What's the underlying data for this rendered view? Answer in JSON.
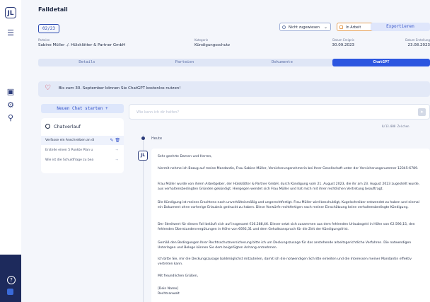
{
  "header": {
    "title": "Falldetail",
    "case_number": "02/23",
    "status_select": "Nicht zugewiesen",
    "progress_select": "In Arbeit",
    "export_label": "Exportieren"
  },
  "meta": {
    "parties_label": "Parteien",
    "parties_value": "Sabine Müller ./. Hülsklötter & Partner GmbH",
    "category_label": "Kategorie",
    "category_value": "Kündigungsschutz",
    "event_label": "Datum Ereignis",
    "event_value": "30.09.2023",
    "created_label": "Datum Erstellung",
    "created_value": "23.08.2023"
  },
  "tabs": [
    "Details",
    "Parteien",
    "Dokumente",
    "ChatGPT"
  ],
  "promo": {
    "text": "Bis zum 30. September können Sie ChatGPT kostenlos nutzen!"
  },
  "sidebar": {
    "new_chat": "Neuen Chat starten  +",
    "history_title": "Chatverlauf",
    "items": [
      "Verfasse ein Anschreiben an di",
      "Erstelle einen 5 Punkte Plan u",
      "Wie ist die Schuldfrage zu bea"
    ]
  },
  "input": {
    "placeholder": "Wie kann ich dir helfen?",
    "counter": "0/13.000 Zeichen"
  },
  "timeline": {
    "today": "Heute"
  },
  "rail": {
    "logo": "JL",
    "chat_avatar": "JL"
  },
  "message": {
    "paragraphs": [
      "Sehr geehrte Damen und Herren,",
      "hiermit nehme ich Bezug auf meine Mandantin, Frau Sabine Müller, Versicherungsnehmerin bei Ihrer Gesellschaft unter der Versicherungsnummer 12345-6789.",
      "Frau Müller wurde von ihrem Arbeitgeber, der Hülsklötter & Partner GmbH, durch Kündigung vom 21. August 2023, die ihr am 23. August 2023 zugestellt wurde, aus verhaltensbedingten Gründen gekündigt. Hiergegen wendet sich Frau Müller und hat mich mit ihrer rechtlichen Vertretung beauftragt.",
      "Die Kündigung ist meines Erachtens nach unverhältnismäßig und ungerechtfertigt. Frau Müller wird beschuldigt, Kugelschreiber entwendet zu haben und einmal ein Dokument ohne vorherige Erlaubnis gedruckt zu haben. Diese Vorwürfe rechtfertigen nach meiner Einschätzung keine verhaltensbedingte Kündigung.",
      "Der Streitwert für diesen Fall beläuft sich auf insgesamt €16.288,46. Dieser setzt sich zusammen aus dem fehlenden Urlaubsgeld in Höhe von €2.596,15, den fehlenden Überstundenvergütungen in Höhe von €692,31 und dem Gehaltsanspruch für die Zeit der Kündigungsfrist.",
      "Gemäß den Bedingungen Ihrer Rechtsschutzversicherung bitte ich um Deckungszusage für das anstehende arbeitsgerichtliche Verfahren. Die notwendigen Unterlagen und Belege können Sie dem beigefügten Anhang entnehmen.",
      "Ich bitte Sie, mir die Deckungszusage baldmöglichst mitzuteilen, damit ich die notwendigen Schritte einleiten und die Interessen meiner Mandantin effektiv vertreten kann.",
      "Mit freundlichen Grüßen,",
      "[Dein Name]",
      "Rechtsanwalt"
    ]
  },
  "colors": {
    "accent": "#2c56e0",
    "heart": "#d7364a",
    "rail_dark": "#1d2a5c"
  },
  "icons": [
    "menu-icon",
    "calendar-icon",
    "settings-icon",
    "users-icon",
    "help-icon",
    "heart-icon",
    "clock-icon",
    "edit-icon",
    "trash-icon",
    "send-icon",
    "chevron-down-icon"
  ]
}
